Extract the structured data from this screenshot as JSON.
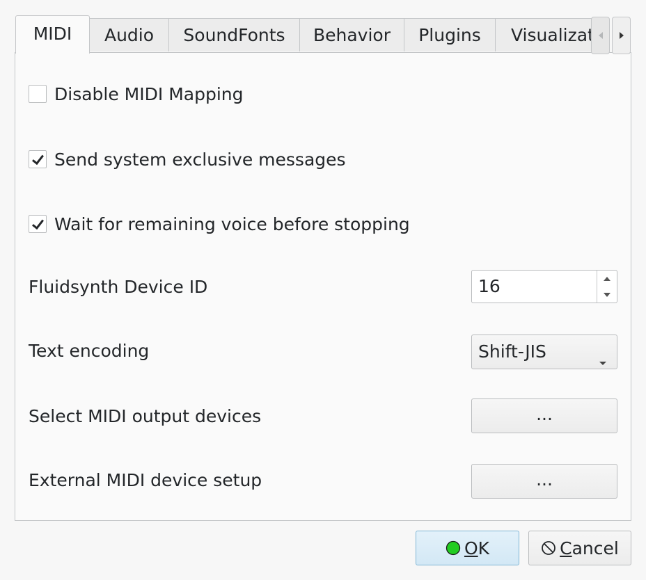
{
  "tabs": [
    {
      "label": "MIDI",
      "active": true
    },
    {
      "label": "Audio"
    },
    {
      "label": "SoundFonts"
    },
    {
      "label": "Behavior"
    },
    {
      "label": "Plugins"
    },
    {
      "label": "Visualizat"
    }
  ],
  "tab_scroll": {
    "left_icon": "triangle-left-icon",
    "right_icon": "triangle-right-icon"
  },
  "options": {
    "disable_mapping": {
      "label": "Disable MIDI Mapping",
      "checked": false
    },
    "send_sysex": {
      "label": "Send system exclusive messages",
      "checked": true
    },
    "wait_voice": {
      "label": "Wait for remaining voice before stopping",
      "checked": true
    }
  },
  "device_id": {
    "label": "Fluidsynth Device ID",
    "value": "16"
  },
  "text_encoding": {
    "label": "Text encoding",
    "value": "Shift-JIS"
  },
  "output_devices": {
    "label": "Select MIDI output devices",
    "button": "..."
  },
  "external_setup": {
    "label": "External MIDI device setup",
    "button": "..."
  },
  "buttons": {
    "ok": {
      "mnemonic": "O",
      "rest": "K",
      "icon": "green-circle-icon",
      "icon_color": "#22cc22"
    },
    "cancel": {
      "mnemonic": "C",
      "rest": "ancel",
      "icon": "cancel-circle-icon"
    }
  }
}
